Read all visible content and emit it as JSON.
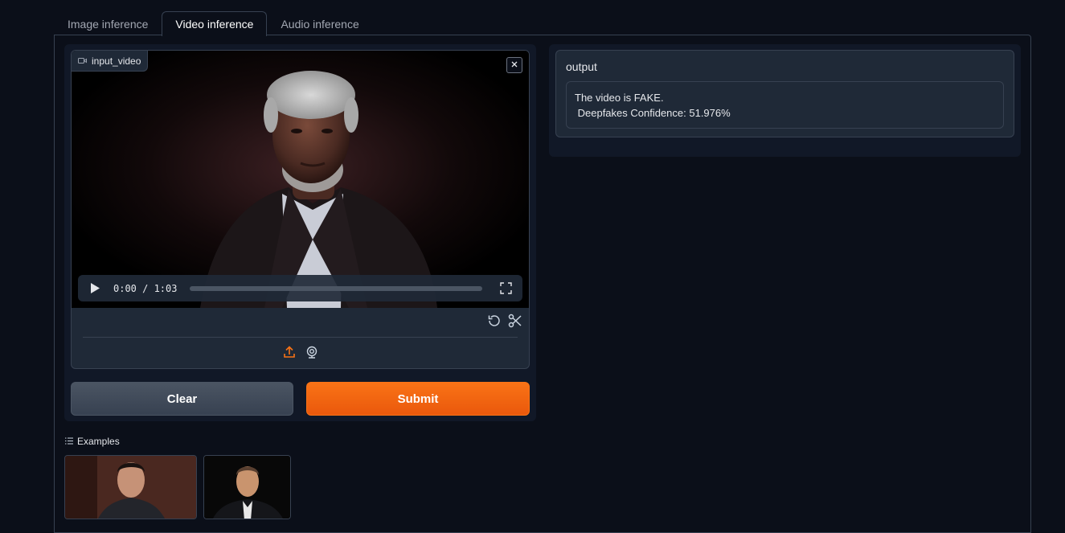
{
  "tabs": [
    {
      "label": "Image inference"
    },
    {
      "label": "Video inference"
    },
    {
      "label": "Audio inference"
    }
  ],
  "video_input": {
    "label": "input_video",
    "current_time": "0:00 / 1:03",
    "progress": 0.0
  },
  "buttons": {
    "clear": "Clear",
    "submit": "Submit"
  },
  "output": {
    "label": "output",
    "line1": "The video is FAKE.",
    "line2": " Deepfakes Confidence: 51.976%"
  },
  "examples": {
    "label": "Examples"
  },
  "colors": {
    "accent": "#f97316",
    "background": "#0b0f19",
    "panel": "#111827",
    "block": "#1f2937",
    "border": "#374151"
  }
}
